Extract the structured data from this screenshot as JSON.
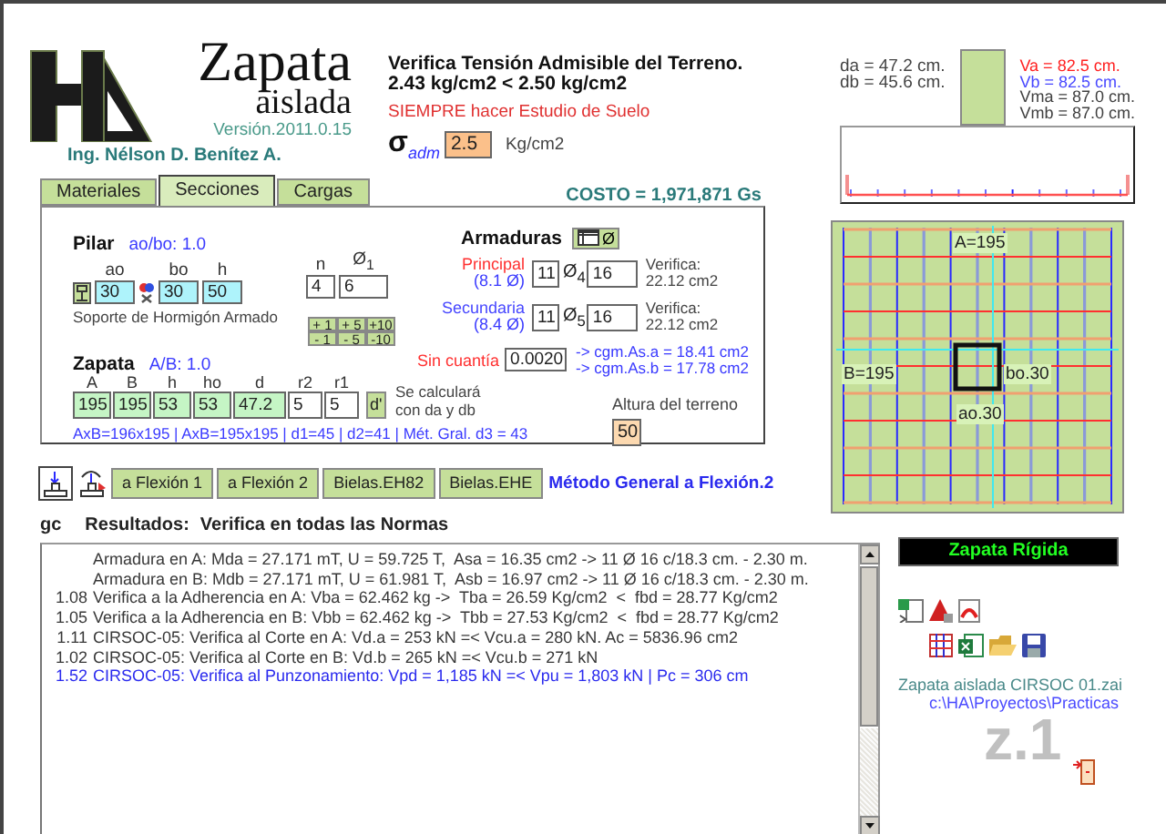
{
  "logo": {
    "title": "Zapata",
    "subtitle": "aislada",
    "version": "Versión.2011.0.15",
    "author": "Ing. Nélson D. Benítez A."
  },
  "soil_check": {
    "title": "Verifica Tensión Admisible del Terreno.",
    "comparison": "2.43 kg/cm2 < 2.50 kg/cm2",
    "warning": "SIEMPRE hacer Estudio de Suelo",
    "symbol": "σ",
    "symbol_sub": "adm",
    "value": "2.5",
    "unit": "Kg/cm2"
  },
  "elevation": {
    "left": [
      "da = 47.2 cm.",
      "db = 45.6 cm."
    ],
    "right": [
      {
        "text": "Va = 82.5 cm.",
        "color": "#ff2020"
      },
      {
        "text": "Vb = 82.5 cm.",
        "color": "#4848ff"
      },
      {
        "text": "Vma = 87.0 cm.",
        "color": "#404040"
      },
      {
        "text": "Vmb = 87.0 cm.",
        "color": "#404040"
      }
    ]
  },
  "tabs": [
    {
      "label": "Materiales",
      "selected": false
    },
    {
      "label": "Secciones",
      "selected": true
    },
    {
      "label": "Cargas",
      "selected": false
    }
  ],
  "cost": "COSTO = 1,971,871 Gs",
  "pilar": {
    "title": "Pilar",
    "ratio": "ao/bo: 1.0",
    "fields": [
      {
        "label": "ao",
        "value": "30"
      },
      {
        "label": "bo",
        "value": "30"
      },
      {
        "label": "h",
        "value": "50"
      }
    ],
    "note": "Soporte de Hormigón Armado"
  },
  "bars": {
    "fields": [
      {
        "label": "n",
        "value": "4"
      },
      {
        "label": "Ø$_{1}$",
        "value": "6"
      }
    ],
    "steppers": [
      "+ 1",
      "+ 5",
      "+10",
      "- 1",
      "- 5",
      "-10"
    ]
  },
  "armaduras": {
    "title": "Armaduras",
    "button": "Ø",
    "rows": [
      {
        "label": "Principal",
        "color": "#ff3030",
        "detail": "(8.1 Ø)",
        "count": "11",
        "symbol": "Ø$_{4}$",
        "diameter": "16",
        "check": [
          "Verifica:",
          "22.12 cm2"
        ]
      },
      {
        "label": "Secundaria",
        "color": "#4848ff",
        "detail": "(8.4 Ø)",
        "count": "11",
        "symbol": "Ø$_{5}$",
        "diameter": "16",
        "check": [
          "Verifica:",
          "22.12 cm2"
        ]
      }
    ]
  },
  "min_ratio": {
    "label": "Sin cuantía",
    "value": "0.0020",
    "results": [
      "-> cgm.As.a = 18.41 cm2",
      "-> cgm.As.b = 17.78 cm2"
    ]
  },
  "zapata": {
    "title": "Zapata",
    "ratio": "A/B: 1.0",
    "fields": [
      {
        "label": "A",
        "value": "195",
        "kind": "dimension"
      },
      {
        "label": "B",
        "value": "195",
        "kind": "dimension"
      },
      {
        "label": "h",
        "value": "53",
        "kind": "dimension"
      },
      {
        "label": "ho",
        "value": "53",
        "kind": "dimension"
      },
      {
        "label": "d",
        "value": "47.2",
        "kind": "dimension"
      },
      {
        "label": "r2",
        "value": "5",
        "kind": "cover"
      },
      {
        "label": "r1",
        "value": "5",
        "kind": "cover"
      }
    ],
    "d_button": "d'",
    "note": [
      "Se calculará",
      "con da y db"
    ],
    "summary": "AxB=196x195 | AxB=195x195 | d1=45 | d2=41 | Mét. Gral. d3 = 43"
  },
  "terrain": {
    "label": "Altura del terreno",
    "value": "50"
  },
  "actions": {
    "buttons": [
      "a Flexión 1",
      "a Flexión 2",
      "Bielas.EH82",
      "Bielas.EHE"
    ],
    "method": "Método General a Flexión.2"
  },
  "plan": {
    "a": "A=195",
    "b": "B=195",
    "bo": "bo.30",
    "ao": "ao.30"
  },
  "results": {
    "code": "gc",
    "title": "Resultados:",
    "subtitle": "Verifica en todas las Normas",
    "lines": [
      {
        "text": "Armadura en A: Mda = 27.171 mT, U = 59.725 T,  Asa = 16.35 cm2 -> 11 Ø 16 c/18.3 cm. - 2.30 m.",
        "color": "#383838"
      },
      {
        "text": "Armadura en B: Mdb = 27.171 mT, U = 61.981 T,  Asb = 16.97 cm2 -> 11 Ø 16 c/18.3 cm. - 2.30 m.",
        "color": "#383838"
      },
      {
        "factor": "1.08",
        "text": "Verifica a la Adherencia en A: Vba = 62.462 kg ->  Tba = 26.59 Kg/cm2  <  fbd = 28.77 Kg/cm2",
        "color": "#383838"
      },
      {
        "factor": "1.05",
        "text": "Verifica a la Adherencia en B: Vbb = 62.462 kg ->  Tbb = 27.53 Kg/cm2  <  fbd = 28.77 Kg/cm2",
        "color": "#383838"
      },
      {
        "factor": "1.11",
        "text": "CIRSOC-05: Verifica al Corte en A: Vd.a = 253 kN =< Vcu.a = 280 kN. Ac = 5836.96 cm2",
        "color": "#383838"
      },
      {
        "factor": "1.02",
        "text": "CIRSOC-05: Verifica al Corte en B: Vd.b = 265 kN =< Vcu.b = 271 kN",
        "color": "#383838"
      },
      {
        "factor": "1.52",
        "text": "CIRSOC-05: Verifica al Punzonamiento: Vpd = 1,185 kN =< Vpu = 1,803 kN | Pc = 306 cm",
        "color": "#2a2aee"
      }
    ]
  },
  "side": {
    "status": "Zapata Rígida",
    "file": "Zapata aislada CIRSOC 01.zai",
    "path": "c:\\HA\\Proyectos\\Practicas",
    "zone": "z.1"
  }
}
